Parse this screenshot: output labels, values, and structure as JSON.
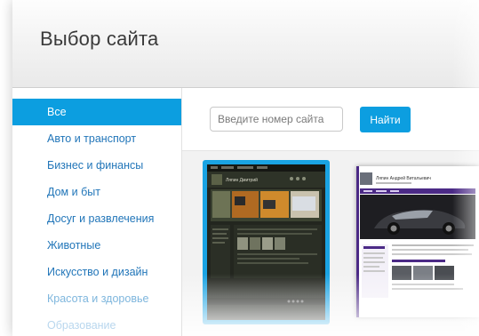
{
  "header": {
    "title": "Выбор сайта"
  },
  "sidebar": {
    "items": [
      {
        "label": "Все"
      },
      {
        "label": "Авто и транспорт"
      },
      {
        "label": "Бизнес и финансы"
      },
      {
        "label": "Дом и быт"
      },
      {
        "label": "Досуг и развлечения"
      },
      {
        "label": "Животные"
      },
      {
        "label": "Искусство и дизайн"
      },
      {
        "label": "Красота и здоровье"
      },
      {
        "label": "Образование"
      }
    ]
  },
  "search": {
    "placeholder": "Введите номер сайта",
    "button_label": "Найти"
  },
  "templates": [
    {
      "site_name": "Ляпин Дмитрий"
    },
    {
      "site_name": "Ляпин Андрей Витальевич"
    }
  ],
  "colors": {
    "accent": "#0c9ee0",
    "link": "#2276b9"
  }
}
